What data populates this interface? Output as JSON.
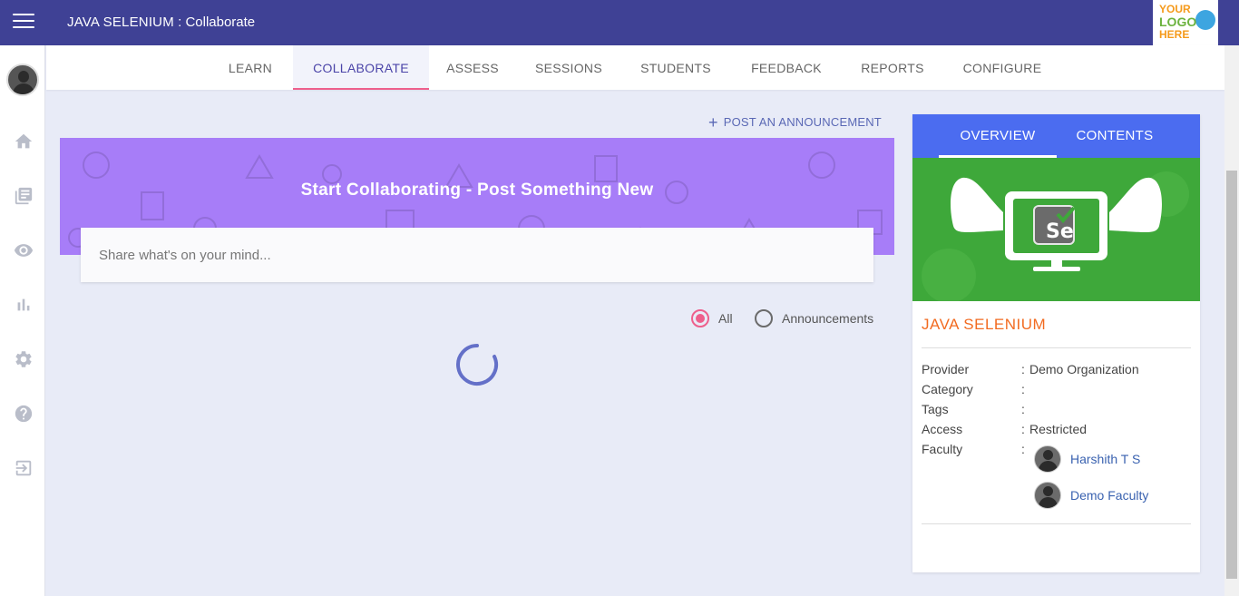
{
  "header": {
    "course_title": "JAVA SELENIUM",
    "separator": " : ",
    "section": "Collaborate",
    "logo": {
      "line1": "YOUR",
      "line2": "LOGO",
      "line3": "HERE"
    }
  },
  "sidebar": {
    "icons": [
      "home-icon",
      "library-icon",
      "eye-icon",
      "bar-chart-icon",
      "gear-icon",
      "help-icon",
      "logout-icon"
    ]
  },
  "tabs": [
    {
      "label": "LEARN",
      "active": false
    },
    {
      "label": "COLLABORATE",
      "active": true
    },
    {
      "label": "ASSESS",
      "active": false
    },
    {
      "label": "SESSIONS",
      "active": false
    },
    {
      "label": "STUDENTS",
      "active": false
    },
    {
      "label": "FEEDBACK",
      "active": false
    },
    {
      "label": "REPORTS",
      "active": false
    },
    {
      "label": "CONFIGURE",
      "active": false
    }
  ],
  "main": {
    "post_announcement_label": "POST AN ANNOUNCEMENT",
    "banner_title": "Start Collaborating - Post Something New",
    "share_placeholder": "Share what's on your mind...",
    "filters": [
      {
        "label": "All",
        "checked": true
      },
      {
        "label": "Announcements",
        "checked": false
      }
    ]
  },
  "card": {
    "tabs": [
      {
        "label": "OVERVIEW",
        "active": true
      },
      {
        "label": "CONTENTS",
        "active": false
      }
    ],
    "course_name": "JAVA SELENIUM",
    "image_badge": "Se",
    "info": [
      {
        "label": "Provider",
        "value": "Demo Organization"
      },
      {
        "label": "Category",
        "value": ""
      },
      {
        "label": "Tags",
        "value": ""
      },
      {
        "label": "Access",
        "value": "Restricted"
      },
      {
        "label": "Faculty",
        "value": ""
      }
    ],
    "faculty": [
      "Harshith T S",
      "Demo Faculty"
    ]
  },
  "colors": {
    "topbar": "#3f4195",
    "accent_pink": "#ee5f8c",
    "banner": "#a77df8",
    "card_tabs": "#4b6cf0",
    "course_name": "#f26b21",
    "image_bg": "#3ea83a"
  }
}
